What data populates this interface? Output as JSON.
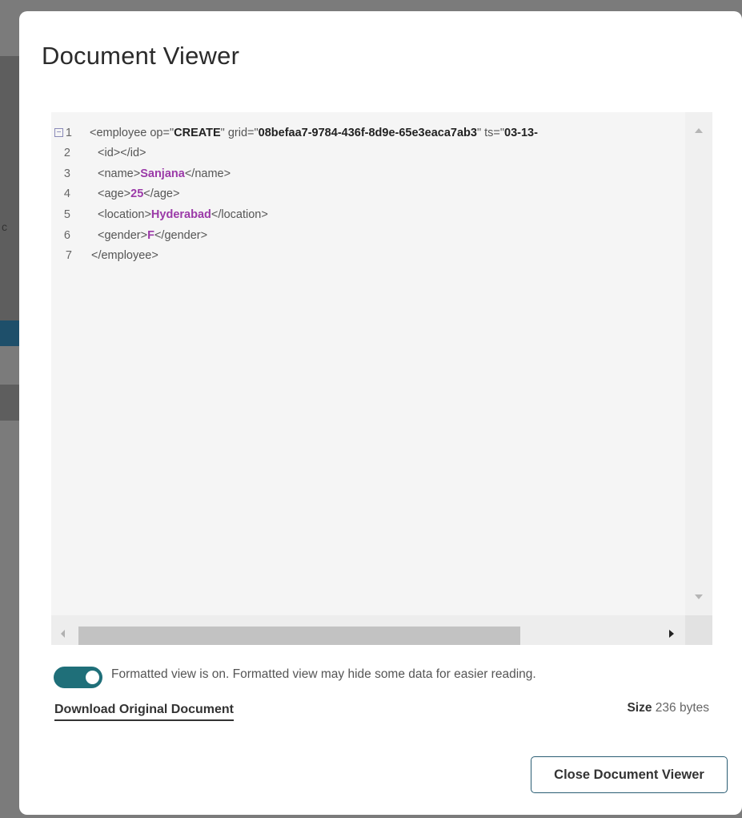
{
  "dialog": {
    "title": "Document Viewer"
  },
  "editor": {
    "lines": [
      {
        "num": "1",
        "parts": [
          {
            "k": "t",
            "v": "<employee op=\""
          },
          {
            "k": "a",
            "v": "CREATE"
          },
          {
            "k": "t",
            "v": "\" grid=\""
          },
          {
            "k": "a",
            "v": "08befaa7-9784-436f-8d9e-65e3eaca7ab3"
          },
          {
            "k": "t",
            "v": "\" ts=\""
          },
          {
            "k": "a",
            "v": "03-13-"
          }
        ]
      },
      {
        "num": "2",
        "parts": [
          {
            "k": "t",
            "v": "<id></id>"
          }
        ]
      },
      {
        "num": "3",
        "parts": [
          {
            "k": "t",
            "v": "<name>"
          },
          {
            "k": "v",
            "v": "Sanjana"
          },
          {
            "k": "t",
            "v": "</name>"
          }
        ]
      },
      {
        "num": "4",
        "parts": [
          {
            "k": "t",
            "v": "<age>"
          },
          {
            "k": "v",
            "v": "25"
          },
          {
            "k": "t",
            "v": "</age>"
          }
        ]
      },
      {
        "num": "5",
        "parts": [
          {
            "k": "t",
            "v": "<location>"
          },
          {
            "k": "v",
            "v": "Hyderabad"
          },
          {
            "k": "t",
            "v": "</location>"
          }
        ]
      },
      {
        "num": "6",
        "parts": [
          {
            "k": "t",
            "v": "<gender>"
          },
          {
            "k": "v",
            "v": "F"
          },
          {
            "k": "t",
            "v": "</gender>"
          }
        ]
      },
      {
        "num": "7",
        "parts": [
          {
            "k": "t",
            "v": "</employee>"
          }
        ]
      }
    ],
    "fold_icon": "collapse-icon"
  },
  "formatted_toggle": {
    "on": true,
    "text": "Formatted view is on. Formatted view may hide some data for easier reading."
  },
  "download_link": "Download Original Document",
  "size": {
    "label": "Size",
    "value": "236 bytes"
  },
  "close_button": "Close Document Viewer",
  "colors": {
    "toggle_on": "#1f6f79",
    "value_purple": "#9b3aa8",
    "button_border": "#2a5d73"
  }
}
